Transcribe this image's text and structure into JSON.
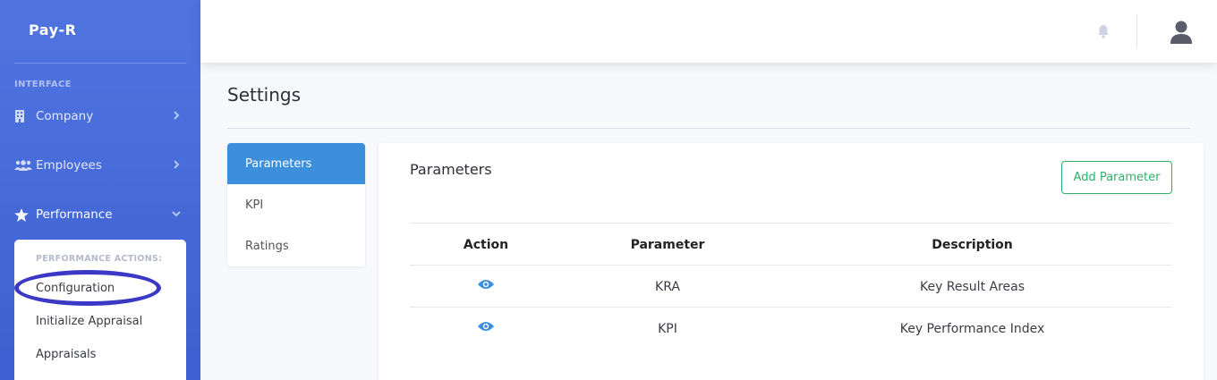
{
  "sidebar": {
    "brand": "Pay-R",
    "heading": "INTERFACE",
    "items": [
      {
        "label": "Company",
        "icon": "building-icon"
      },
      {
        "label": "Employees",
        "icon": "users-icon"
      },
      {
        "label": "Performance",
        "icon": "star-icon"
      }
    ],
    "performance_menu": {
      "heading": "PERFORMANCE ACTIONS:",
      "items": [
        "Configuration",
        "Initialize Appraisal",
        "Appraisals"
      ]
    }
  },
  "page": {
    "title": "Settings"
  },
  "tabs": [
    "Parameters",
    "KPI",
    "Ratings"
  ],
  "card": {
    "title": "Parameters",
    "add_button": "Add Parameter",
    "columns": [
      "Action",
      "Parameter",
      "Description"
    ],
    "rows": [
      {
        "parameter": "KRA",
        "description": "Key Result Areas"
      },
      {
        "parameter": "KPI",
        "description": "Key Performance Index"
      }
    ]
  },
  "colors": {
    "sidebar": "#4e73df",
    "active_tab": "#3b8fdb",
    "add_button": "#2eb067",
    "annotation_ring": "#3a38c4"
  }
}
